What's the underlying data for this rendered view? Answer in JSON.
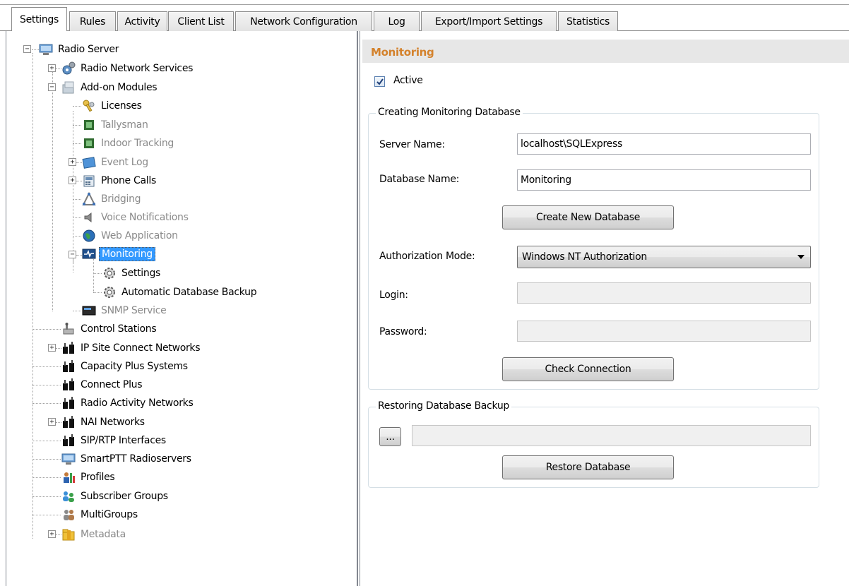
{
  "tabs": [
    {
      "label": "Settings"
    },
    {
      "label": "Rules"
    },
    {
      "label": "Activity"
    },
    {
      "label": "Client List"
    },
    {
      "label": "Network Configuration"
    },
    {
      "label": "Log"
    },
    {
      "label": "Export/Import Settings"
    },
    {
      "label": "Statistics"
    }
  ],
  "tree": {
    "items": [
      {
        "label": "Radio Server",
        "icon": "server-icon"
      },
      {
        "label": "Radio Network Services",
        "icon": "network-services-icon"
      },
      {
        "label": "Add-on Modules",
        "icon": "modules-icon"
      },
      {
        "label": "Licenses",
        "icon": "keys-icon"
      },
      {
        "label": "Tallysman",
        "icon": "board-icon"
      },
      {
        "label": "Indoor Tracking",
        "icon": "board-icon"
      },
      {
        "label": "Event Log",
        "icon": "event-log-icon"
      },
      {
        "label": "Phone Calls",
        "icon": "phone-icon"
      },
      {
        "label": "Bridging",
        "icon": "bridge-icon"
      },
      {
        "label": "Voice Notifications",
        "icon": "speaker-icon"
      },
      {
        "label": "Web Application",
        "icon": "globe-icon"
      },
      {
        "label": "Monitoring",
        "icon": "monitoring-icon"
      },
      {
        "label": "Settings",
        "icon": "gear-icon"
      },
      {
        "label": "Automatic Database Backup",
        "icon": "gear-icon"
      },
      {
        "label": "SNMP Service",
        "icon": "terminal-icon"
      },
      {
        "label": "Control Stations",
        "icon": "control-station-icon"
      },
      {
        "label": "IP Site Connect Networks",
        "icon": "radio-network-icon"
      },
      {
        "label": "Capacity Plus Systems",
        "icon": "radio-network-icon"
      },
      {
        "label": "Connect Plus",
        "icon": "radio-network-icon"
      },
      {
        "label": "Radio Activity Networks",
        "icon": "radio-network-icon"
      },
      {
        "label": "NAI Networks",
        "icon": "radio-network-icon"
      },
      {
        "label": "SIP/RTP Interfaces",
        "icon": "radio-network-icon"
      },
      {
        "label": "SmartPTT Radioservers",
        "icon": "server-icon"
      },
      {
        "label": "Profiles",
        "icon": "profiles-icon"
      },
      {
        "label": "Subscriber Groups",
        "icon": "users-icon"
      },
      {
        "label": "MultiGroups",
        "icon": "multigroups-icon"
      },
      {
        "label": "Metadata",
        "icon": "folder-icon"
      }
    ]
  },
  "monitoring": {
    "title": "Monitoring",
    "active_label": "Active",
    "active_checked": true,
    "create_group": {
      "title": "Creating Monitoring Database",
      "server_name_label": "Server Name:",
      "server_name_value": "localhost\\SQLExpress",
      "database_name_label": "Database Name:",
      "database_name_value": "Monitoring",
      "create_button": "Create New Database",
      "auth_mode_label": "Authorization Mode:",
      "auth_mode_value": "Windows NT Authorization",
      "login_label": "Login:",
      "login_value": "",
      "password_label": "Password:",
      "password_value": "",
      "check_button": "Check Connection"
    },
    "restore_group": {
      "title": "Restoring Database Backup",
      "browse_button": "...",
      "path_value": "",
      "restore_button": "Restore Database"
    }
  },
  "colors": {
    "title_accent": "#d4822c",
    "selection": "#3399ff",
    "disabled_text": "#8a8a8a"
  }
}
